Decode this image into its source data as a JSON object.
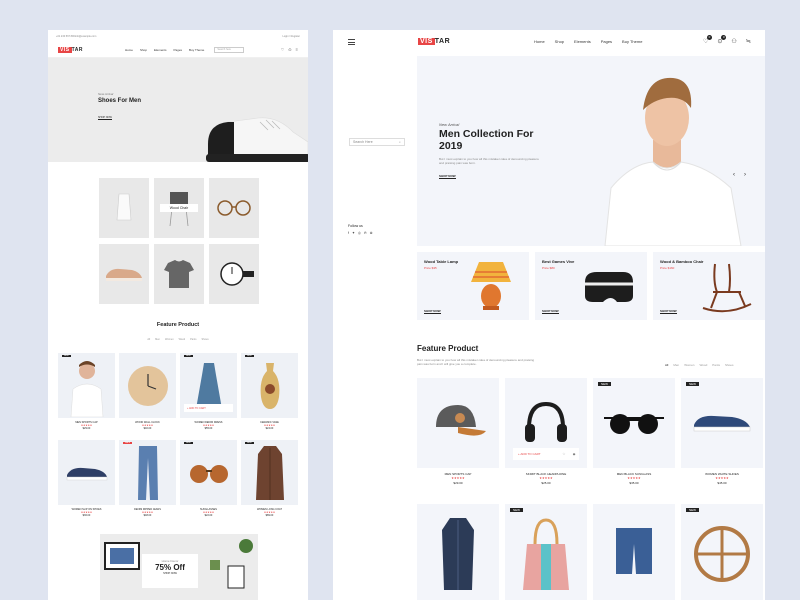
{
  "colors": {
    "accent": "#e84545",
    "background": "#dfe4f0"
  },
  "left": {
    "topbar": {
      "phone": "+01 234 567 890",
      "email": "info@example.com",
      "links": "Login / Register"
    },
    "logo": {
      "a": "VIS",
      "b": "TAR"
    },
    "nav": [
      "Home",
      "Shop",
      "Elements",
      "Pages",
      "Buy Theme"
    ],
    "search_placeholder": "Search here",
    "hero": {
      "new_arrival": "New Arrival",
      "title": "Shoes For Men",
      "button": "SHOP NOW"
    },
    "grid": {
      "label": "Wood Chair"
    },
    "feature": {
      "title": "Feature Product",
      "tabs": [
        "All",
        "Men",
        "Women",
        "Wood",
        "Pants",
        "Shoes"
      ]
    },
    "products": [
      {
        "name": "MEN SPORTS CAP",
        "stars": "★★★★★",
        "price": "$29.00",
        "badge": "NEW"
      },
      {
        "name": "WOOD WALL CLOCK",
        "stars": "★★★★★",
        "price": "$40.00",
        "badge": ""
      },
      {
        "name": "WOMEN DENIM DRESS",
        "stars": "★★★★★",
        "price": "$55.00",
        "badge": "NEW"
      },
      {
        "name": "CERAMIC VASE",
        "stars": "★★★★★",
        "price": "$24.00",
        "badge": "NEW"
      },
      {
        "name": "WOMEN SLIP ON SHOES",
        "stars": "★★★★★",
        "price": "$36.00",
        "badge": ""
      },
      {
        "name": "DENIM RIPPED JEANS",
        "stars": "★★★★★",
        "price": "$48.00",
        "badge": "SALE"
      },
      {
        "name": "SUNGLASSES",
        "stars": "★★★★★",
        "price": "$22.00",
        "badge": "NEW"
      },
      {
        "name": "WOMEN LONG COAT",
        "stars": "★★★★★",
        "price": "$89.00",
        "badge": "NEW"
      }
    ],
    "add_to_cart": "+ ADD TO CART",
    "banner": {
      "small": "Home Decor",
      "big": "75% Off",
      "cta": "SHOP NOW"
    }
  },
  "right": {
    "logo": {
      "a": "VIS",
      "b": "TAR"
    },
    "nav": [
      "Home",
      "Shop",
      "Elements",
      "Pages",
      "Buy Theme"
    ],
    "badges": {
      "wishlist": "0",
      "cart": "0"
    },
    "search_placeholder": "Search Here",
    "follow": "Follow us",
    "hero": {
      "new_arrival": "New Arrival",
      "title": "Men Collection For 2019",
      "desc": "But I must explain to you how all this mistaken idea of denouncing pleasure and praising pain was born.",
      "button": "SHOP NOW",
      "dots": [
        "1",
        "2",
        "3"
      ]
    },
    "categories": [
      {
        "title": "Wood Table Lamp",
        "price": "Price $35",
        "button": "SHOP NOW"
      },
      {
        "title": "Best Games Vive",
        "price": "Price $80",
        "button": "SHOP NOW"
      },
      {
        "title": "Wood & Bamboo Chair",
        "price": "Price $160",
        "button": "SHOP NOW"
      }
    ],
    "feature": {
      "title": "Feature Product",
      "desc": "But I must explain to you how all this mistaken idea of denouncing pleasure and praising pain was born and I will give you a complete.",
      "tabs": [
        "All",
        "Men",
        "Women",
        "Wood",
        "Pants",
        "Shoes"
      ]
    },
    "products": [
      {
        "name": "MEN SPORTS CAP",
        "stars": "★★★★★",
        "price": "$29.00",
        "badge": ""
      },
      {
        "name": "SKIMIT BLACK HEADPHONE",
        "stars": "★★★★★",
        "price": "$25.00",
        "badge": ""
      },
      {
        "name": "MEN BLACK SUNGLASS",
        "stars": "★★★★★",
        "price": "$35.00",
        "badge": "NEW"
      },
      {
        "name": "WOMEN WHITE SHOES",
        "stars": "★★★★★",
        "price": "$45.00",
        "badge": "NEW"
      }
    ],
    "add_to_cart": "+ ADD TO CART",
    "row2_badges": [
      "",
      "NEW",
      "",
      "NEW"
    ]
  }
}
